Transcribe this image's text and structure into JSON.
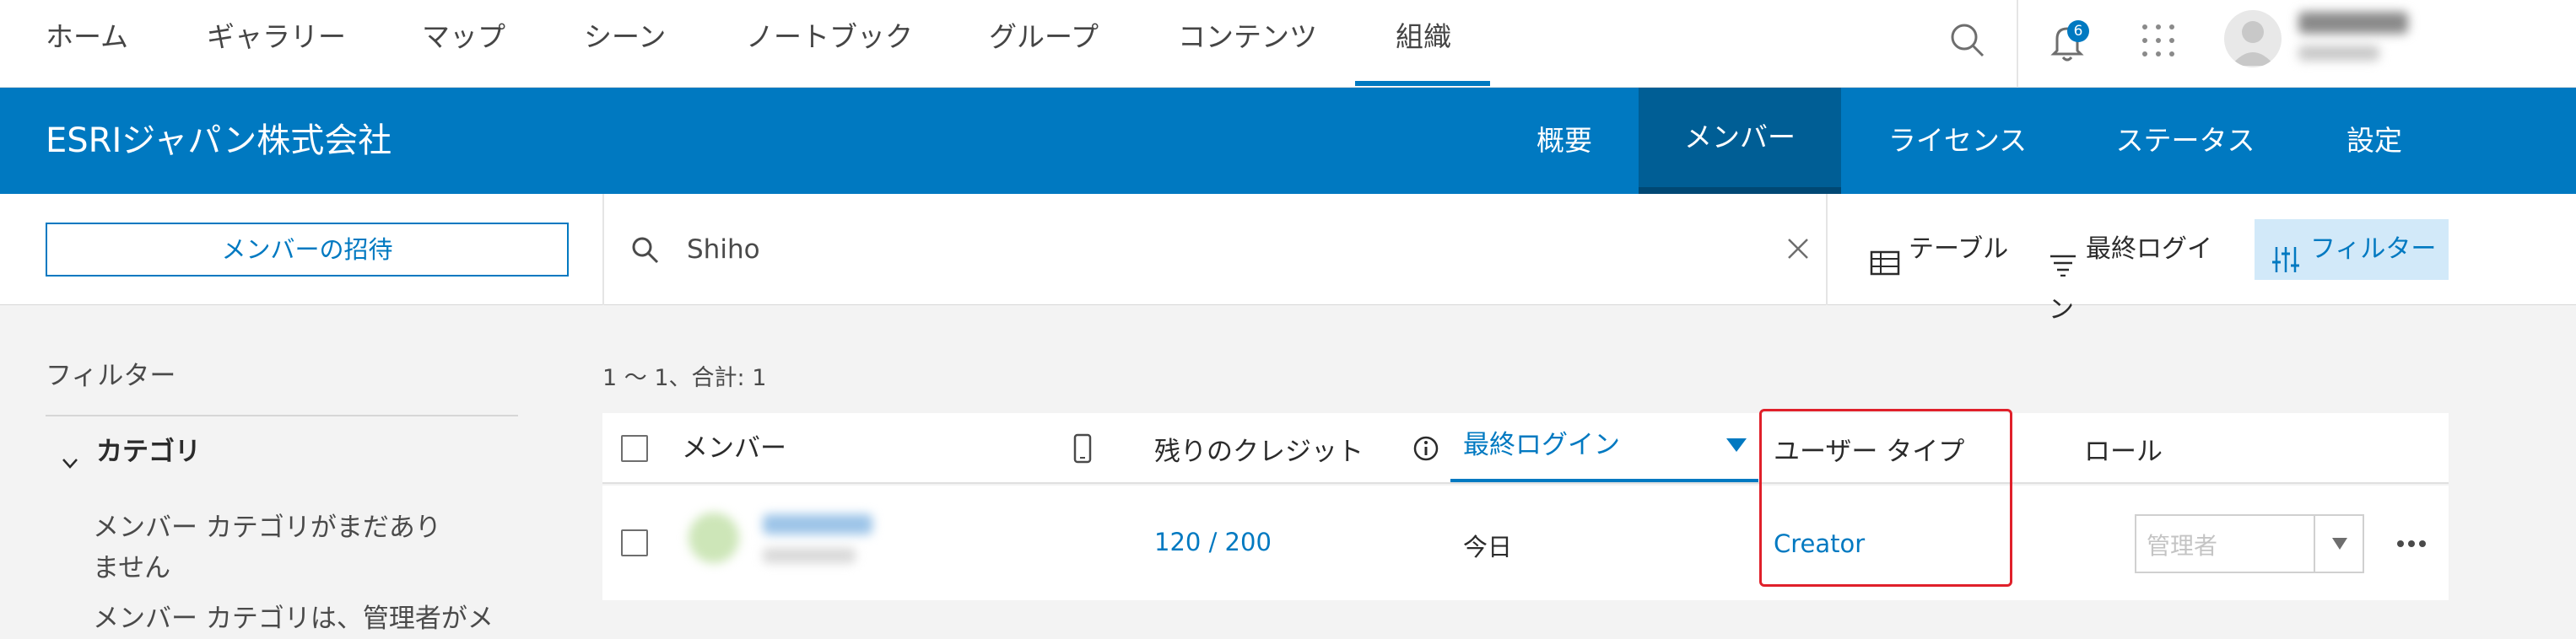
{
  "topnav": {
    "items": [
      {
        "label": "ホーム"
      },
      {
        "label": "ギャラリー"
      },
      {
        "label": "マップ"
      },
      {
        "label": "シーン"
      },
      {
        "label": "ノートブック"
      },
      {
        "label": "グループ"
      },
      {
        "label": "コンテンツ"
      },
      {
        "label": "組織"
      }
    ],
    "active_item": "組織",
    "notification_count": "6",
    "icons": [
      "search-icon",
      "bell-icon",
      "apps-grid-icon"
    ]
  },
  "org": {
    "title": "ESRIジャパン株式会社",
    "tabs": [
      {
        "label": "概要"
      },
      {
        "label": "メンバー"
      },
      {
        "label": "ライセンス"
      },
      {
        "label": "ステータス"
      },
      {
        "label": "設定"
      }
    ],
    "active_tab": "メンバー"
  },
  "toolbar": {
    "invite_label": "メンバーの招待",
    "search_value": "Shiho",
    "table_label": "テーブル",
    "sort_label": "最終ログイン",
    "filter_label": "フィルター"
  },
  "sidebar": {
    "title": "フィルター",
    "category_header": "カテゴリ",
    "category_empty_line1": "メンバー カテゴリがまだあり",
    "category_empty_line2": "ません",
    "category_note": "メンバー カテゴリは、管理者がメ"
  },
  "results": {
    "count_text": "1 ～ 1、合計: 1",
    "columns": {
      "member": "メンバー",
      "credits": "残りのクレジット",
      "last_login": "最終ログイン",
      "user_type": "ユーザー タイプ",
      "role": "ロール"
    },
    "rows": [
      {
        "credits": "120 / 200",
        "last_login": "今日",
        "user_type": "Creator",
        "role": "管理者"
      }
    ]
  },
  "colors": {
    "brand_blue": "#0079c1",
    "active_tab": "#005e95",
    "highlight_red": "#e0202a"
  }
}
